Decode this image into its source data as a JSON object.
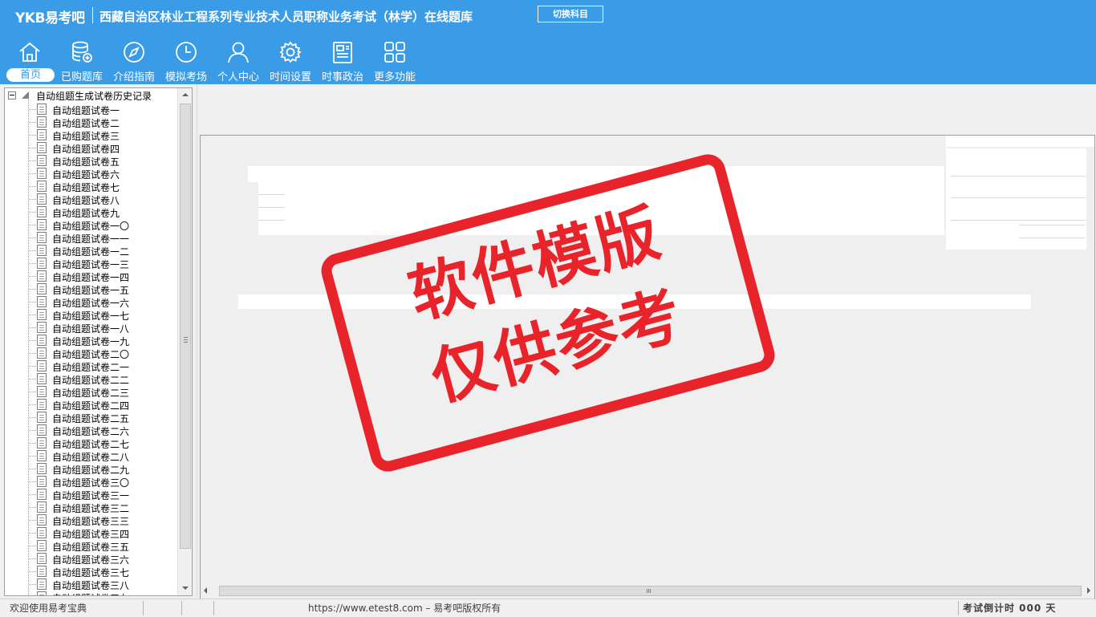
{
  "header": {
    "logo": "YKB易考吧",
    "title": "西藏自治区林业工程系列专业技术人员职称业务考试（林学）在线题库",
    "switch_subject": "切换科目"
  },
  "toolbar": [
    {
      "label": "首页",
      "icon": "home-icon"
    },
    {
      "label": "已购题库",
      "icon": "database-icon"
    },
    {
      "label": "介绍指南",
      "icon": "compass-icon"
    },
    {
      "label": "模拟考场",
      "icon": "clock-icon"
    },
    {
      "label": "个人中心",
      "icon": "user-icon"
    },
    {
      "label": "时间设置",
      "icon": "gear-icon"
    },
    {
      "label": "时事政治",
      "icon": "news-icon"
    },
    {
      "label": "更多功能",
      "icon": "grid-icon"
    }
  ],
  "tree": {
    "root": "自动组题生成试卷历史记录",
    "items": [
      "自动组题试卷一",
      "自动组题试卷二",
      "自动组题试卷三",
      "自动组题试卷四",
      "自动组题试卷五",
      "自动组题试卷六",
      "自动组题试卷七",
      "自动组题试卷八",
      "自动组题试卷九",
      "自动组题试卷一〇",
      "自动组题试卷一一",
      "自动组题试卷一二",
      "自动组题试卷一三",
      "自动组题试卷一四",
      "自动组题试卷一五",
      "自动组题试卷一六",
      "自动组题试卷一七",
      "自动组题试卷一八",
      "自动组题试卷一九",
      "自动组题试卷二〇",
      "自动组题试卷二一",
      "自动组题试卷二二",
      "自动组题试卷二三",
      "自动组题试卷二四",
      "自动组题试卷二五",
      "自动组题试卷二六",
      "自动组题试卷二七",
      "自动组题试卷二八",
      "自动组题试卷二九",
      "自动组题试卷三〇",
      "自动组题试卷三一",
      "自动组题试卷三二",
      "自动组题试卷三三",
      "自动组题试卷三四",
      "自动组题试卷三五",
      "自动组题试卷三六",
      "自动组题试卷三七",
      "自动组题试卷三八",
      "自动组题试卷三九"
    ]
  },
  "watermark": {
    "line1": "软件模版",
    "line2": "仅供参考",
    "color": "#e8232a"
  },
  "statusbar": {
    "welcome": "欢迎使用易考宝典",
    "copyright": "https://www.etest8.com – 易考吧版权所有",
    "countdown": "考试倒计时 000 天"
  },
  "colors": {
    "header": "#3a9be6",
    "accent_text": "#ffffff"
  }
}
